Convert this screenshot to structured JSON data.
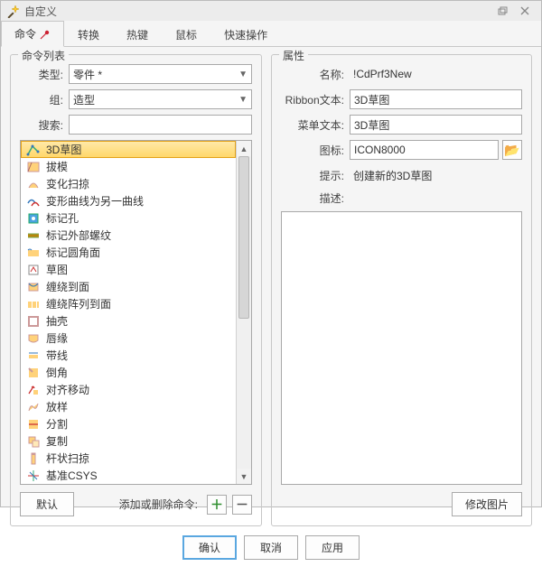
{
  "titlebar": {
    "title": "自定义"
  },
  "tabs": [
    {
      "label": "命令"
    },
    {
      "label": "转换"
    },
    {
      "label": "热键"
    },
    {
      "label": "鼠标"
    },
    {
      "label": "快速操作"
    }
  ],
  "active_tab_index": 0,
  "left": {
    "group_title": "命令列表",
    "type_label": "类型:",
    "type_value": "零件 *",
    "group_label": "组:",
    "group_value": "造型",
    "search_label": "搜索:",
    "search_value": "",
    "list": [
      "3D草图",
      "拔模",
      "变化扫掠",
      "变形曲线为另一曲线",
      "标记孔",
      "标记外部螺纹",
      "标记圆角面",
      "草图",
      "缠绕到面",
      "缠绕阵列到面",
      "抽壳",
      "唇缘",
      "带线",
      "倒角",
      "对齐移动",
      "放样",
      "分割",
      "复制",
      "杆状扫掠",
      "基准CSYS"
    ],
    "selected_index": 0,
    "default_btn": "默认",
    "add_remove_label": "添加或删除命令:"
  },
  "right": {
    "group_title": "属性",
    "name_label": "名称:",
    "name_value": "!CdPrf3New",
    "ribbon_label": "Ribbon文本:",
    "ribbon_value": "3D草图",
    "menu_label": "菜单文本:",
    "menu_value": "3D草图",
    "icon_label": "图标:",
    "icon_value": "ICON8000",
    "hint_label": "提示:",
    "hint_value": "创建新的3D草图",
    "desc_label": "描述:",
    "change_pic_btn": "修改图片"
  },
  "dialog_buttons": {
    "ok": "确认",
    "cancel": "取消",
    "apply": "应用"
  },
  "icons": {
    "plus": "＋",
    "minus": "－",
    "folder": "📂"
  }
}
